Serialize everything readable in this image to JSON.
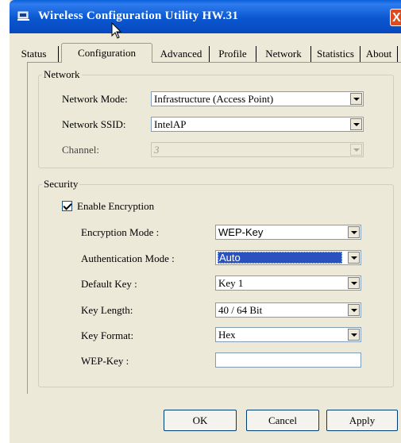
{
  "window": {
    "title": "Wireless Configuration Utility HW.31",
    "close_glyph": "X"
  },
  "tabs": [
    {
      "label": "Status",
      "active": false
    },
    {
      "label": "Configuration",
      "active": true
    },
    {
      "label": "Advanced",
      "active": false
    },
    {
      "label": "Profile",
      "active": false
    },
    {
      "label": "Network",
      "active": false
    },
    {
      "label": "Statistics",
      "active": false
    },
    {
      "label": "About",
      "active": false
    }
  ],
  "network": {
    "legend": "Network",
    "mode_label": "Network Mode:",
    "mode_value": "Infrastructure (Access Point)",
    "ssid_label": "Network SSID:",
    "ssid_value": "IntelAP",
    "channel_label": "Channel:",
    "channel_value": "3"
  },
  "security": {
    "legend": "Security",
    "enable_encryption_label": "Enable Encryption",
    "enable_encryption_checked": true,
    "encryption_mode_label": "Encryption Mode :",
    "encryption_mode_value": "WEP-Key",
    "auth_mode_label": "Authentication Mode :",
    "auth_mode_value": "Auto",
    "default_key_label": "Default Key :",
    "default_key_value": "Key 1",
    "key_length_label": "Key Length:",
    "key_length_value": "40 / 64 Bit",
    "key_format_label": "Key Format:",
    "key_format_value": "Hex",
    "wep_key_label": "WEP-Key :",
    "wep_key_value": ""
  },
  "buttons": {
    "ok": "OK",
    "cancel": "Cancel",
    "apply": "Apply"
  },
  "colors": {
    "title_bar": "#0a57d0",
    "dialog_bg": "#ece9d8",
    "selection": "#2a52be",
    "close_button": "#e04a1c"
  }
}
